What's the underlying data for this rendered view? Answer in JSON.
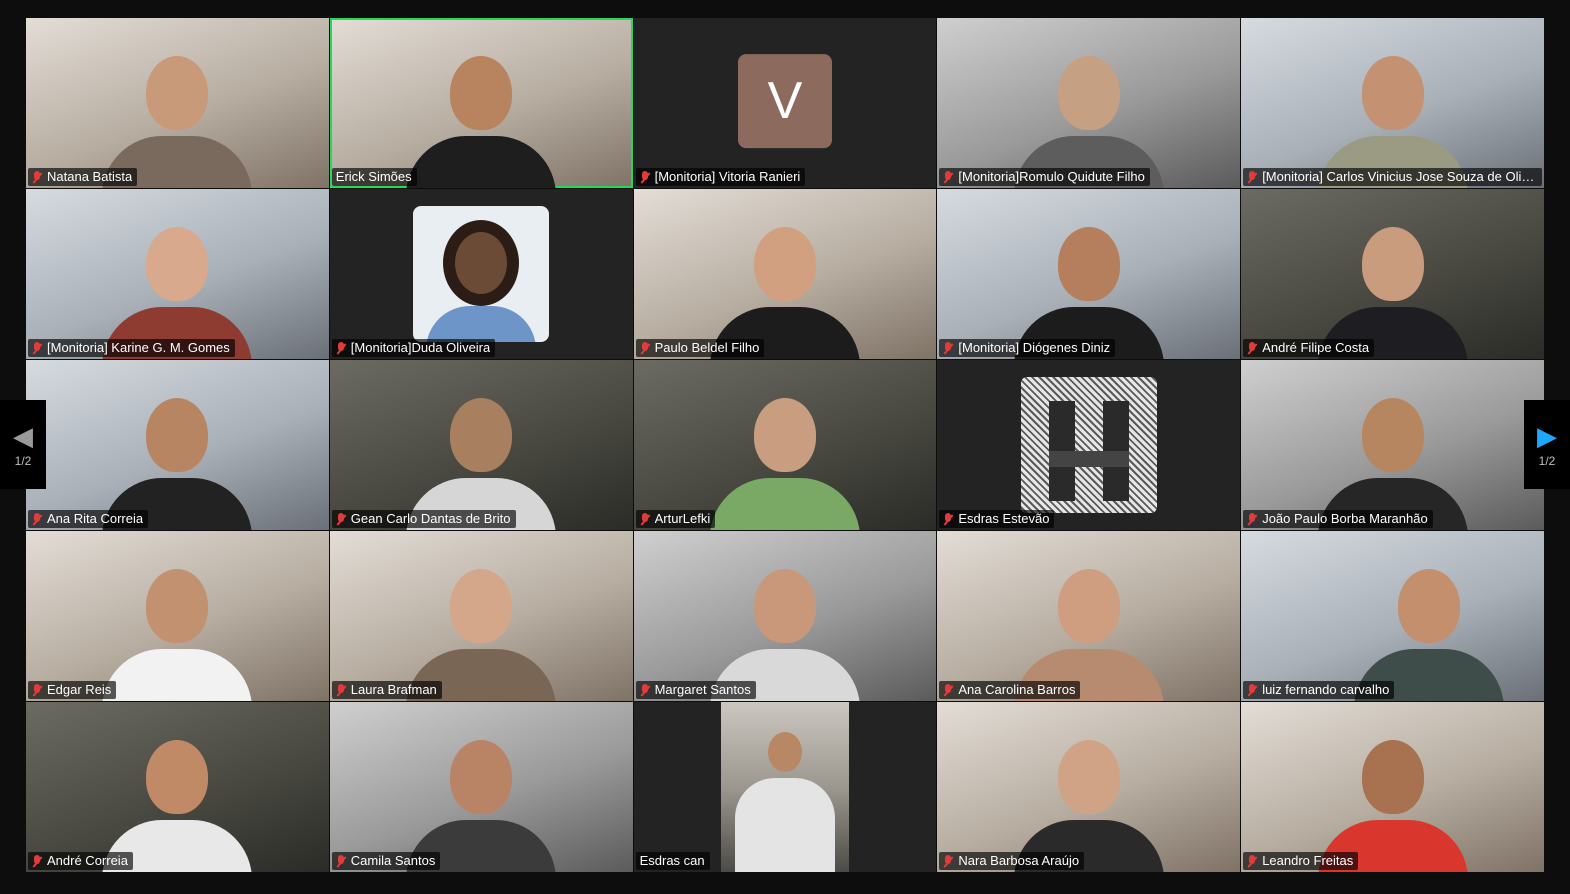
{
  "pagination": {
    "prev_arrow": "◀",
    "next_arrow": "▶",
    "page_label_left": "1/2",
    "page_label_right": "1/2"
  },
  "colors": {
    "active_speaker_border": "#23d959",
    "muted_icon": "#e33a3a",
    "next_arrow": "#1ea7fd"
  },
  "participants": [
    {
      "name": "Natana Batista",
      "muted": true
    },
    {
      "name": "Erick Simões",
      "muted": false,
      "active": true
    },
    {
      "name": "[Monitoria] Vitoria Ranieri",
      "muted": true,
      "avatar_letter": "V"
    },
    {
      "name": "[Monitoria]Romulo Quidute Filho",
      "muted": true
    },
    {
      "name": "[Monitoria] Carlos Vinicius Jose Souza de Oliv...",
      "muted": true
    },
    {
      "name": "[Monitoria] Karine G. M. Gomes",
      "muted": true
    },
    {
      "name": "[Monitoria]Duda Oliveira",
      "muted": true
    },
    {
      "name": "Paulo Beldel Filho",
      "muted": true
    },
    {
      "name": "[Monitoria] Diógenes Diniz",
      "muted": true
    },
    {
      "name": "André Filipe Costa",
      "muted": true
    },
    {
      "name": "Ana Rita Correia",
      "muted": true
    },
    {
      "name": "Gean Carlo Dantas de Brito",
      "muted": true
    },
    {
      "name": "ArturLefki",
      "muted": true
    },
    {
      "name": "Esdras Estevão",
      "muted": true
    },
    {
      "name": "João Paulo Borba Maranhão",
      "muted": true
    },
    {
      "name": "Edgar Reis",
      "muted": true
    },
    {
      "name": "Laura Brafman",
      "muted": true
    },
    {
      "name": "Margaret Santos",
      "muted": true
    },
    {
      "name": "Ana Carolina Barros",
      "muted": true
    },
    {
      "name": "luiz fernando carvalho",
      "muted": true
    },
    {
      "name": "André Correia",
      "muted": true
    },
    {
      "name": "Camila Santos",
      "muted": true
    },
    {
      "name": "Esdras can",
      "muted": false
    },
    {
      "name": "Nara Barbosa Araújo",
      "muted": true
    },
    {
      "name": "Leandro Freitas",
      "muted": true
    }
  ]
}
